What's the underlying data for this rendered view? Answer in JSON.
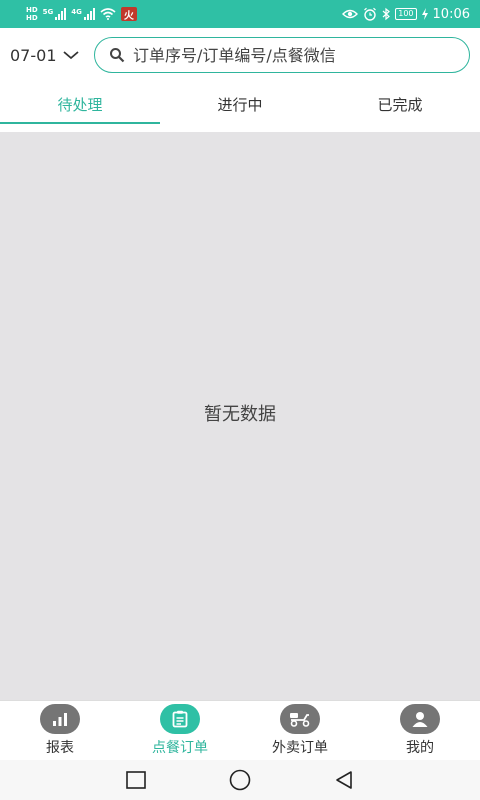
{
  "status_bar": {
    "hd_top": "HD",
    "hd_bottom": "HD",
    "net1": "5G",
    "net2": "4G",
    "fire_badge": "火",
    "battery": "100",
    "time": "10:06"
  },
  "header": {
    "date": "07-01",
    "search_placeholder": "订单序号/订单编号/点餐微信"
  },
  "tabs": [
    {
      "label": "待处理",
      "active": true
    },
    {
      "label": "进行中",
      "active": false
    },
    {
      "label": "已完成",
      "active": false
    }
  ],
  "content": {
    "empty_text": "暂无数据"
  },
  "bottom_nav": [
    {
      "label": "报表",
      "icon": "bar-chart-icon",
      "active": false
    },
    {
      "label": "点餐订单",
      "icon": "clipboard-icon",
      "active": true
    },
    {
      "label": "外卖订单",
      "icon": "scooter-icon",
      "active": false
    },
    {
      "label": "我的",
      "icon": "user-icon",
      "active": false
    }
  ],
  "colors": {
    "accent": "#2fb59d",
    "status_bar": "#2fc0a5",
    "content_bg": "#e4e3e5",
    "nav_icon_inactive": "#757575"
  }
}
